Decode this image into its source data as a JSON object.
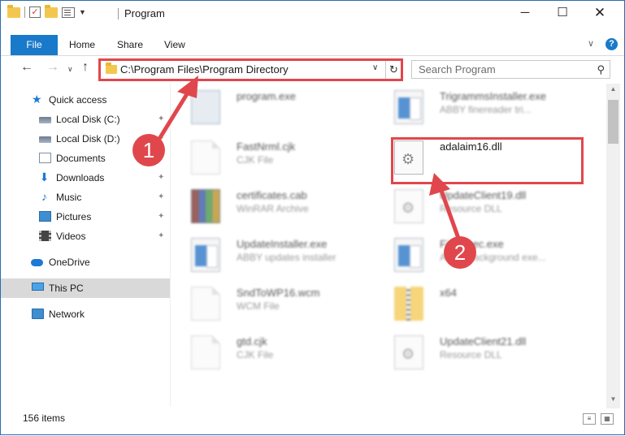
{
  "window": {
    "title": "Program",
    "minimize_glyph": "─",
    "maximize_glyph": "☐",
    "close_glyph": "✕"
  },
  "ribbon": {
    "tabs": [
      "File",
      "Home",
      "Share",
      "View"
    ],
    "expand_glyph": "∨",
    "help_glyph": "?"
  },
  "nav": {
    "back_glyph": "←",
    "forward_glyph": "→",
    "recent_glyph": "∨",
    "up_glyph": "↑"
  },
  "address": {
    "path": "C:\\Program Files\\Program Directory",
    "dropdown_glyph": "∨",
    "refresh_glyph": "↻"
  },
  "search": {
    "placeholder": "Search Program",
    "icon": "search-icon",
    "icon_glyph": "⚲"
  },
  "sidebar": {
    "items": [
      {
        "label": "Quick access",
        "icon": "star-icon",
        "pinned": false
      },
      {
        "label": "Local Disk (C:)",
        "icon": "drive-icon",
        "pinned": true
      },
      {
        "label": "Local Disk (D:)",
        "icon": "drive-icon",
        "pinned": true
      },
      {
        "label": "Documents",
        "icon": "documents-icon",
        "pinned": true
      },
      {
        "label": "Downloads",
        "icon": "downloads-icon",
        "pinned": true
      },
      {
        "label": "Music",
        "icon": "music-icon",
        "pinned": true
      },
      {
        "label": "Pictures",
        "icon": "pictures-icon",
        "pinned": true
      },
      {
        "label": "Videos",
        "icon": "videos-icon",
        "pinned": true
      },
      {
        "label": "OneDrive",
        "icon": "cloud-icon",
        "pinned": false
      },
      {
        "label": "This PC",
        "icon": "computer-icon",
        "pinned": false,
        "selected": true
      },
      {
        "label": "Network",
        "icon": "network-icon",
        "pinned": false
      }
    ],
    "pin_glyph": "📌"
  },
  "files": [
    {
      "name": "program.exe",
      "type": "",
      "icon": "setup-icon"
    },
    {
      "name": "TrigrammsInstaller.exe",
      "type": "ABBY finereader tri...",
      "icon": "exe-icon"
    },
    {
      "name": "FastNrml.cjk",
      "type": "CJK File",
      "icon": "doc-icon"
    },
    {
      "name": "adalaim16.dll",
      "type": "",
      "icon": "dll-icon"
    },
    {
      "name": "certificates.cab",
      "type": "WinRAR Archive",
      "icon": "winrar-icon"
    },
    {
      "name": "UpdateClient19.dll",
      "type": "Resource DLL",
      "icon": "dll-icon"
    },
    {
      "name": "UpdateInstaller.exe",
      "type": "ABBY updates installer",
      "icon": "exe-icon"
    },
    {
      "name": "FineExec.exe",
      "type": "ABBY background exe...",
      "icon": "exe-icon"
    },
    {
      "name": "SndToWP16.wcm",
      "type": "WCM File",
      "icon": "doc-icon"
    },
    {
      "name": "x64",
      "type": "",
      "icon": "zip-folder-icon"
    },
    {
      "name": "gtd.cjk",
      "type": "CJK File",
      "icon": "doc-icon"
    },
    {
      "name": "UpdateClient21.dll",
      "type": "Resource DLL",
      "icon": "dll-icon"
    }
  ],
  "annotations": {
    "step1": "1",
    "step2": "2",
    "color": "#e0474c"
  },
  "status": {
    "item_count": "156 items"
  },
  "colors": {
    "accent": "#1979ca",
    "selection": "#d9d9d9",
    "highlight": "#e0474c"
  }
}
